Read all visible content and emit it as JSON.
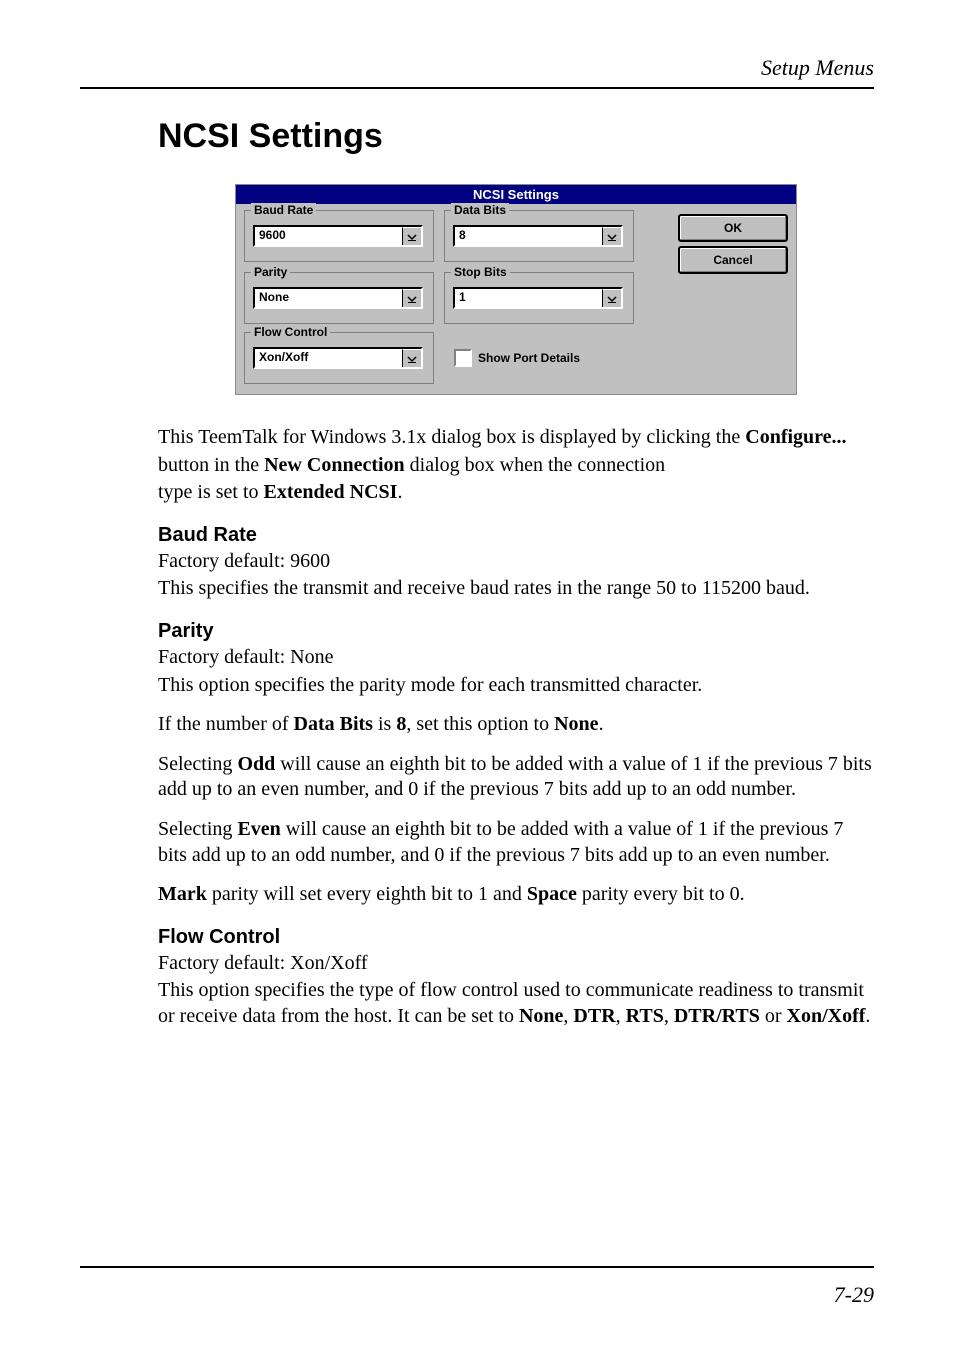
{
  "header": {
    "running": "Setup Menus"
  },
  "footer": {
    "page_number": "7-29"
  },
  "title": "NCSI Settings",
  "dialog": {
    "title": "NCSI Settings",
    "baud_rate": {
      "label": "Baud Rate",
      "value": "9600"
    },
    "data_bits": {
      "label": "Data Bits",
      "value": "8"
    },
    "parity": {
      "label": "Parity",
      "value": "None"
    },
    "stop_bits": {
      "label": "Stop Bits",
      "value": "1"
    },
    "flow_control": {
      "label": "Flow Control",
      "value": "Xon/Xoff"
    },
    "show_port_details": {
      "label": "Show Port Details",
      "checked": false
    },
    "buttons": {
      "ok": "OK",
      "cancel": "Cancel"
    }
  },
  "intro": {
    "line1a": "This TeemTalk for Windows 3.1x dialog box is displayed by clicking the ",
    "line1b": "Configure...",
    "line2a": "button in the ",
    "line2b": "New Connection",
    "line2c": " dialog box when the connection",
    "line3a": "type is set to ",
    "line3b": "Extended NCSI",
    "line3c": "."
  },
  "baud": {
    "heading": "Baud Rate",
    "default": "Factory default: 9600",
    "desc": "This specifies the transmit and receive baud rates in the range 50 to 115200 baud."
  },
  "parity": {
    "heading": "Parity",
    "default": "Factory default: None",
    "desc": "This option specifies the parity mode for each transmitted character.",
    "none_a": "If the number of ",
    "none_b": "Data Bits",
    "none_c": " is ",
    "none_d": "8",
    "none_e": ", set this option to ",
    "none_f": "None",
    "none_g": ".",
    "odd_a": "Selecting ",
    "odd_b": "Odd",
    "odd_c": " will cause an eighth bit to be added with a value of 1 if the previous 7 bits add up to an even number, and 0 if the previous 7 bits add up to an odd number.",
    "even_a": "Selecting ",
    "even_b": "Even",
    "even_c": " will cause an eighth bit to be added with a value of 1 if the previous 7 bits add up to an odd number, and 0 if the previous 7 bits add up to an even number.",
    "mark_a": "Mark",
    "mark_b": " parity will set every eighth bit to 1 and ",
    "mark_c": "Space",
    "mark_d": " parity every bit to 0."
  },
  "flow": {
    "heading": "Flow Control",
    "default": "Factory default: Xon/Xoff",
    "desc_a": "This option specifies the type of flow control used to communicate readiness to transmit or receive data from the host. It can be set to ",
    "desc_b": "None",
    "desc_c": ", ",
    "desc_d": "DTR",
    "desc_e": ", ",
    "desc_f": "RTS",
    "desc_g": ", ",
    "desc_h": "DTR/RTS",
    "desc_i": " or ",
    "desc_j": "Xon/Xoff",
    "desc_k": "."
  }
}
